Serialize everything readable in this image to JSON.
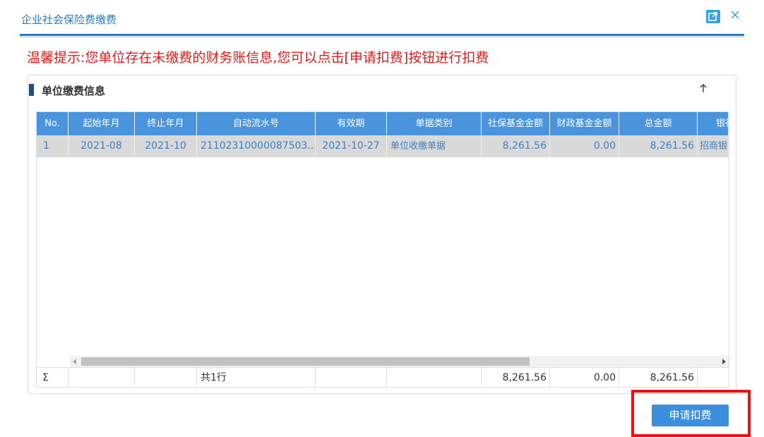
{
  "dialog": {
    "title": "企业社会保险费缴费",
    "icons": {
      "popout": "popout-icon",
      "close": "close-icon"
    }
  },
  "notice": "温馨提示:您单位存在未缴费的财务账信息,您可以点击[申请扣费]按钮进行扣费",
  "panel": {
    "title": "单位缴费信息",
    "collapse_icon": "arrow-up-icon"
  },
  "table": {
    "columns": [
      "No.",
      "起始年月",
      "终止年月",
      "自动流水号",
      "有效期",
      "单据类别",
      "社保基金金额",
      "财政基金金额",
      "总金额",
      "银行"
    ],
    "rows": [
      {
        "no": "1",
        "start": "2021-08",
        "end": "2021-10",
        "serial": "21102310000087503...",
        "valid": "2021-10-27",
        "type": "单位收缴单据",
        "social_amount": "8,261.56",
        "finance_amount": "0.00",
        "total": "8,261.56",
        "bank": "招商银行"
      }
    ],
    "footer": {
      "sigma": "Σ",
      "count": "共1行",
      "social_amount": "8,261.56",
      "finance_amount": "0.00",
      "total": "8,261.56"
    }
  },
  "actions": {
    "apply_label": "申请扣费"
  },
  "colors": {
    "accent": "#2c7bc1",
    "header": "#4a94dd",
    "notice": "#e01b1b",
    "button": "#3b8fdc",
    "highlight": "#ee1111"
  }
}
